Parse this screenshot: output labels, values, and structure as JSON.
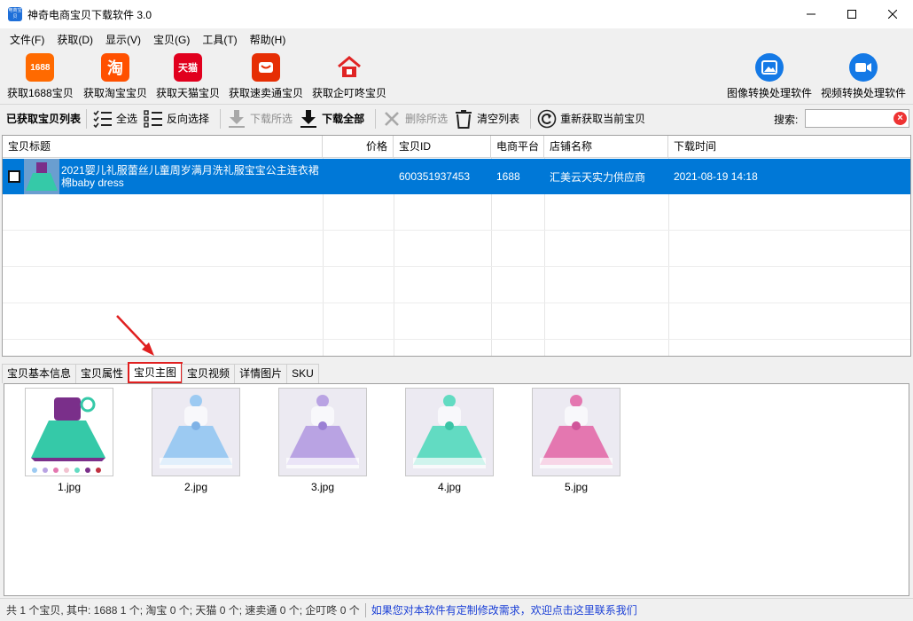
{
  "window": {
    "title": "神奇电商宝贝下载软件 3.0",
    "icon_text": "电商宝贝"
  },
  "menu": [
    "文件(F)",
    "获取(D)",
    "显示(V)",
    "宝贝(G)",
    "工具(T)",
    "帮助(H)"
  ],
  "big_toolbar": {
    "items": [
      {
        "label": "获取1688宝贝",
        "icon": "1688-icon",
        "icon_text": "1688",
        "color": "#ff6a00"
      },
      {
        "label": "获取淘宝宝贝",
        "icon": "taobao-icon",
        "icon_text": "淘",
        "color": "#ff5000"
      },
      {
        "label": "获取天猫宝贝",
        "icon": "tmall-icon",
        "icon_text": "天猫",
        "color": "#e1001e"
      },
      {
        "label": "获取速卖通宝贝",
        "icon": "aliexpress-icon",
        "icon_text": "",
        "color": "#e62e04"
      },
      {
        "label": "获取企叮咚宝贝",
        "icon": "house-icon",
        "icon_text": "",
        "color": "#e02424"
      }
    ],
    "right_items": [
      {
        "label": "图像转换处理软件",
        "icon": "image-convert-icon",
        "color": "#1479e6"
      },
      {
        "label": "视频转换处理软件",
        "icon": "video-convert-icon",
        "color": "#1479e6"
      }
    ]
  },
  "action_bar": {
    "title": "已获取宝贝列表",
    "select_all": "全选",
    "invert": "反向选择",
    "download_selected": "下载所选",
    "download_all": "下载全部",
    "delete_selected": "删除所选",
    "clear_list": "清空列表",
    "refetch": "重新获取当前宝贝",
    "search_label": "搜索:",
    "search_value": ""
  },
  "grid": {
    "columns": [
      "宝贝标题",
      "价格",
      "宝贝ID",
      "电商平台",
      "店铺名称",
      "下载时间"
    ],
    "rows": [
      {
        "checked": false,
        "title": "2021婴儿礼服蕾丝儿童周岁满月洗礼服宝宝公主连衣裙棉baby dress",
        "price": "",
        "id": "600351937453",
        "platform": "1688",
        "shop": "汇美云天实力供应商",
        "time": "2021-08-19 14:18"
      }
    ]
  },
  "tabs": {
    "items": [
      "宝贝基本信息",
      "宝贝属性",
      "宝贝主图",
      "宝贝视频",
      "详情图片",
      "SKU"
    ],
    "active": "宝贝主图"
  },
  "images": [
    {
      "name": "1.jpg",
      "dress_color": "#35c9a8",
      "top_color": "#7a2f8a"
    },
    {
      "name": "2.jpg",
      "dress_color": "#9ccaf2",
      "top_color": "#eef3fb"
    },
    {
      "name": "3.jpg",
      "dress_color": "#b9a3e3",
      "top_color": "#f3effa"
    },
    {
      "name": "4.jpg",
      "dress_color": "#62dbc2",
      "top_color": "#eefaf6"
    },
    {
      "name": "5.jpg",
      "dress_color": "#e477b0",
      "top_color": "#fbeef5"
    }
  ],
  "status": {
    "summary": "共 1 个宝贝, 其中: 1688 1 个; 淘宝 0 个; 天猫 0 个; 速卖通 0 个; 企叮咚 0 个",
    "link": "如果您对本软件有定制修改需求，欢迎点击这里联系我们"
  }
}
